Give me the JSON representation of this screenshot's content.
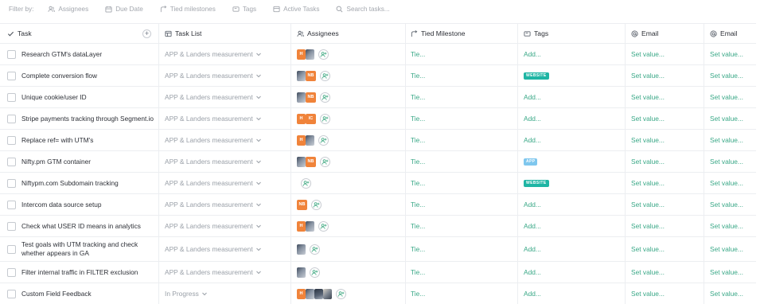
{
  "filter_bar": {
    "label": "Filter by:",
    "items": [
      {
        "icon": "assignees-icon",
        "label": "Assignees"
      },
      {
        "icon": "calendar-icon",
        "label": "Due Date"
      },
      {
        "icon": "milestone-icon",
        "label": "Tied milestones"
      },
      {
        "icon": "tag-icon",
        "label": "Tags"
      },
      {
        "icon": "tasks-icon",
        "label": "Active Tasks"
      },
      {
        "icon": "search-icon",
        "label": "Search tasks..."
      }
    ]
  },
  "columns": {
    "task": "Task",
    "task_list": "Task List",
    "assignees": "Assignees",
    "tied_milestone": "Tied Milestone",
    "tags": "Tags",
    "email1": "Email",
    "email2": "Email"
  },
  "placeholders": {
    "milestone": "Tie...",
    "tag": "Add...",
    "email": "Set value..."
  },
  "colors": {
    "accent_green": "#3aa887",
    "avatar_orange": "#f0833a",
    "tag_website": "#1fb5a4",
    "tag_app": "#7fc7ee"
  },
  "rows": [
    {
      "task": "Research GTM's dataLayer",
      "list": "APP & Landers measurement",
      "assignees": [
        {
          "type": "initials",
          "text": "H"
        },
        {
          "type": "photo",
          "text": ""
        }
      ],
      "tag": null
    },
    {
      "task": "Complete conversion flow",
      "list": "APP & Landers measurement",
      "assignees": [
        {
          "type": "photo",
          "text": ""
        },
        {
          "type": "initials",
          "text": "NB"
        }
      ],
      "tag": "WEBSITE"
    },
    {
      "task": "Unique cookie/user ID",
      "list": "APP & Landers measurement",
      "assignees": [
        {
          "type": "photo",
          "text": ""
        },
        {
          "type": "initials",
          "text": "NB"
        }
      ],
      "tag": null
    },
    {
      "task": "Stripe payments tracking through Segment.io",
      "list": "APP & Landers measurement",
      "assignees": [
        {
          "type": "initials",
          "text": "H"
        },
        {
          "type": "initials",
          "text": "IC"
        }
      ],
      "tag": null
    },
    {
      "task": "Replace ref= with UTM's",
      "list": "APP & Landers measurement",
      "assignees": [
        {
          "type": "initials",
          "text": "H"
        },
        {
          "type": "photo",
          "text": ""
        }
      ],
      "tag": null
    },
    {
      "task": "Nifty.pm GTM container",
      "list": "APP & Landers measurement",
      "assignees": [
        {
          "type": "photo",
          "text": ""
        },
        {
          "type": "initials",
          "text": "NB"
        }
      ],
      "tag": "APP"
    },
    {
      "task": "Niftypm.com Subdomain tracking",
      "list": "APP & Landers measurement",
      "assignees": [],
      "tag": "WEBSITE"
    },
    {
      "task": "Intercom data source setup",
      "list": "APP & Landers measurement",
      "assignees": [
        {
          "type": "initials",
          "text": "NB"
        }
      ],
      "tag": null
    },
    {
      "task": "Check what USER ID means in analytics",
      "list": "APP & Landers measurement",
      "assignees": [
        {
          "type": "initials",
          "text": "H"
        },
        {
          "type": "photo",
          "text": ""
        }
      ],
      "tag": null
    },
    {
      "task": "Test goals with UTM tracking and check whether appears in GA",
      "list": "APP & Landers measurement",
      "assignees": [
        {
          "type": "photo",
          "text": ""
        }
      ],
      "tag": null
    },
    {
      "task": "Filter internal traffic in FILTER exclusion",
      "list": "APP & Landers measurement",
      "assignees": [
        {
          "type": "photo",
          "text": ""
        }
      ],
      "tag": null
    },
    {
      "task": "Custom Field Feedback",
      "list": "In Progress",
      "assignees": [
        {
          "type": "initials",
          "text": "H"
        },
        {
          "type": "photo",
          "text": ""
        },
        {
          "type": "photo",
          "text": ""
        },
        {
          "type": "photo",
          "text": ""
        }
      ],
      "tag": null
    }
  ]
}
